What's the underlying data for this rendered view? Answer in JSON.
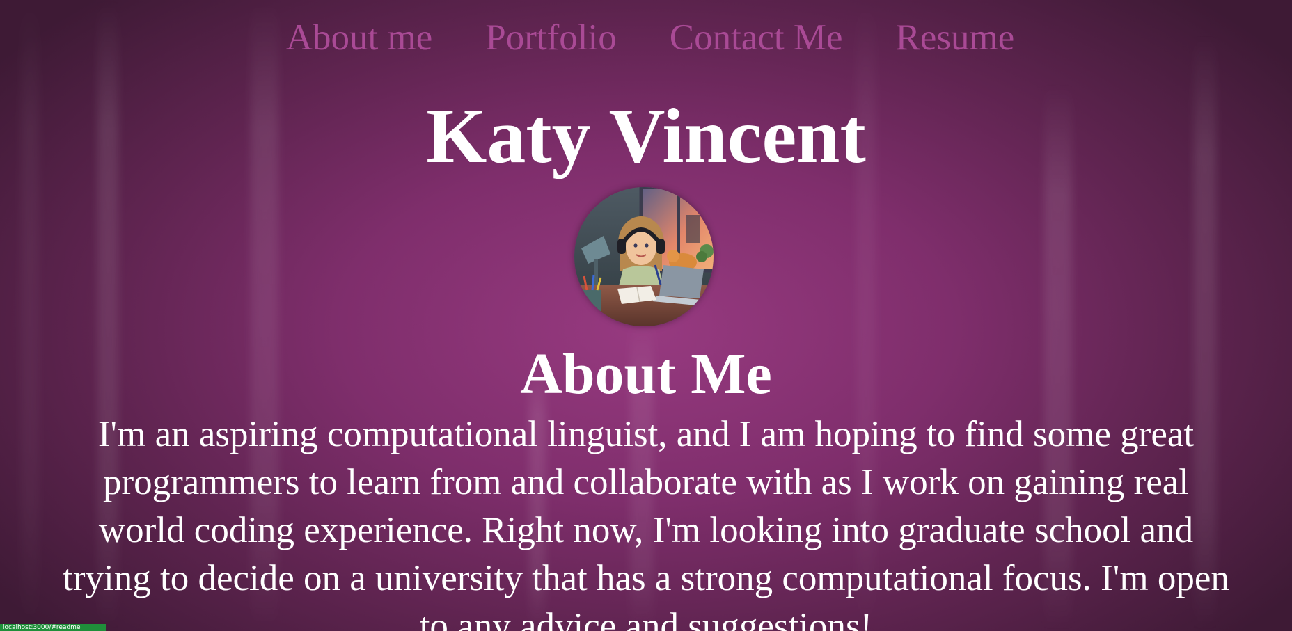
{
  "nav": {
    "items": [
      {
        "label": "About me"
      },
      {
        "label": "Portfolio"
      },
      {
        "label": "Contact Me"
      },
      {
        "label": "Resume"
      }
    ]
  },
  "header": {
    "name": "Katy Vincent"
  },
  "avatar": {
    "icon": "bitmoji-avatar-at-desk-icon"
  },
  "about": {
    "title": "About Me",
    "body": "I'm an aspiring computational linguist, and I am hoping to find some great\nprogrammers to learn from and collaborate with as I work on gaining real\nworld coding experience. Right now, I'm looking into graduate school and\ntrying to decide on a university that has a strong computational focus. I'm open\nto any advice and suggestions!"
  },
  "badge": {
    "text": "localhost:3000/#readme"
  },
  "colors": {
    "nav_link": "#a94a95",
    "background_center": "#973a80",
    "background_edge": "#3e1a35",
    "text": "#ffffff",
    "badge": "#1f8f3a"
  }
}
